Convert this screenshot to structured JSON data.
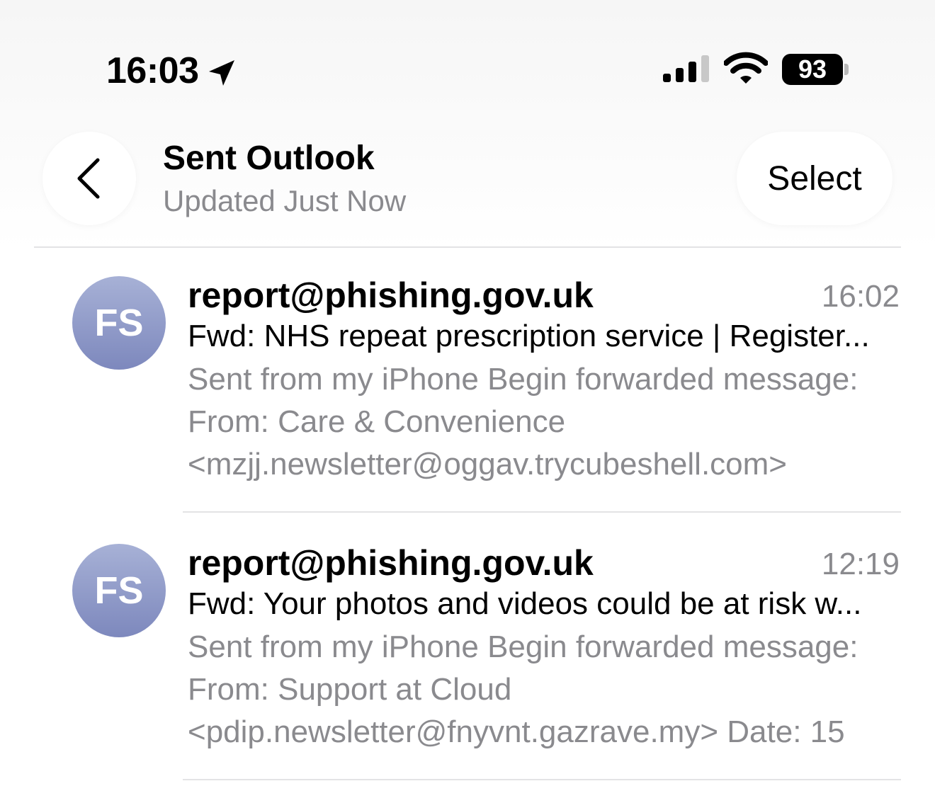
{
  "status_bar": {
    "time": "16:03",
    "battery": "93",
    "icons": [
      "location-arrow-icon",
      "signal-bars-icon",
      "wifi-icon",
      "battery-icon"
    ]
  },
  "header": {
    "title": "Sent Outlook",
    "subtitle": "Updated Just Now",
    "select_label": "Select",
    "back_icon": "chevron-left-icon"
  },
  "messages": [
    {
      "avatar": "FS",
      "sender": "report@phishing.gov.uk",
      "time": "16:02",
      "subject": "Fwd: NHS repeat prescription service | Register...",
      "preview_lines": [
        "Sent from my iPhone Begin forwarded message:",
        "From: Care & Convenience",
        "<mzjj.newsletter@oggav.trycubeshell.com>"
      ]
    },
    {
      "avatar": "FS",
      "sender": "report@phishing.gov.uk",
      "time": "12:19",
      "subject": "Fwd: Your photos and videos could be at risk w...",
      "preview_lines": [
        "Sent from my iPhone Begin forwarded message:",
        "From: Support at Cloud",
        "<pdip.newsletter@fnyvnt.gazrave.my> Date: 15"
      ]
    }
  ],
  "colors": {
    "avatar_top": "#a7b1d6",
    "avatar_bottom": "#7d88bd",
    "secondary_text": "#8a8a8e",
    "divider": "#e3e3e5"
  }
}
